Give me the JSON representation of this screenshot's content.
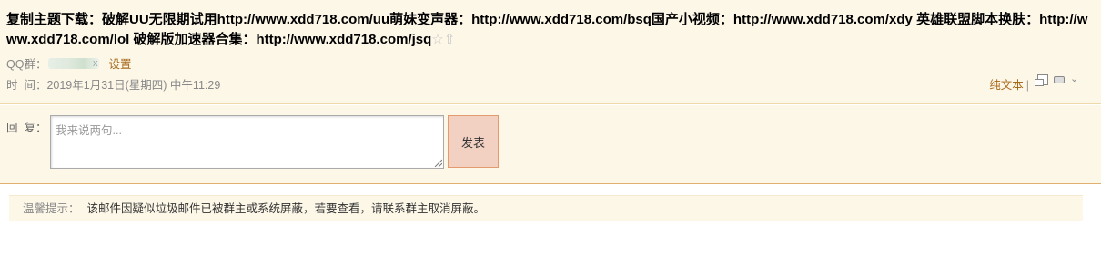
{
  "mail": {
    "subject": "复制主题下载：破解UU无限期试用http://www.xdd718.com/uu萌妹变声器：http://www.xdd718.com/bsq国产小视频：http://www.xdd718.com/xdy 英雄联盟脚本换肤：http://www.xdd718.com/lol 破解版加速器合集：http://www.xdd718.com/jsq",
    "star_icon": "☆",
    "pin_icon": "⇧",
    "qq_label": "QQ群：",
    "qq_tail": "x",
    "settings_link": "设置",
    "time_label": "时  间：",
    "time_value": "2019年1月31日(星期四) 中午11:29"
  },
  "tools": {
    "plain_text": "纯文本",
    "separator": "|",
    "more_icon": "⌄"
  },
  "reply": {
    "label": "回  复：",
    "placeholder": "我来说两句...",
    "send_label": "发表"
  },
  "notice": {
    "label": "温馨提示：",
    "text": "该邮件因疑似垃圾邮件已被群主或系统屏蔽，若要查看，请联系群主取消屏蔽。"
  },
  "colors": {
    "header_bg": "#fdf7e8",
    "link": "#a86a1a",
    "send_bg": "#f2d1c3",
    "send_border": "#e39a6e"
  }
}
